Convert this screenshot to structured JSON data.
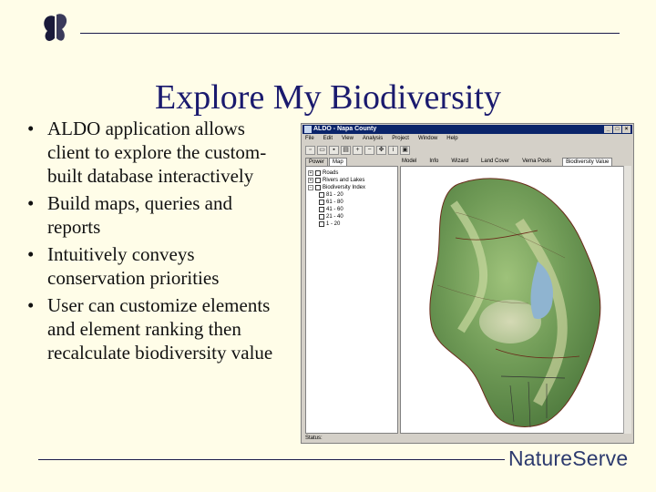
{
  "slide": {
    "title": "Explore My Biodiversity",
    "bullets": [
      "ALDO application allows client to explore the custom-built database interactively",
      "Build maps, queries and reports",
      "Intuitively conveys conservation priorities",
      "User can customize elements and element ranking then recalculate biodiversity value"
    ]
  },
  "brand": {
    "name": "NatureServe"
  },
  "app": {
    "title": "ALDO - Napa County",
    "menu": [
      "File",
      "Edit",
      "View",
      "Analysis",
      "Project",
      "Window",
      "Help"
    ],
    "left_tabs": [
      "Power",
      "Map"
    ],
    "right_tabs": [
      "Model",
      "Info",
      "Wizard",
      "Land Cover",
      "Vema Pools",
      "Biodiversity Value"
    ],
    "tree": [
      {
        "label": "Roads",
        "level": 0
      },
      {
        "label": "Rivers and Lakes",
        "level": 0
      },
      {
        "label": "Biodiversity Index",
        "level": 0
      },
      {
        "label": "81 - 20",
        "level": 1
      },
      {
        "label": "61 - 80",
        "level": 1
      },
      {
        "label": "41 - 60",
        "level": 1
      },
      {
        "label": "21 - 40",
        "level": 1
      },
      {
        "label": "1 - 20",
        "level": 1
      }
    ],
    "status_label": "Status:"
  }
}
